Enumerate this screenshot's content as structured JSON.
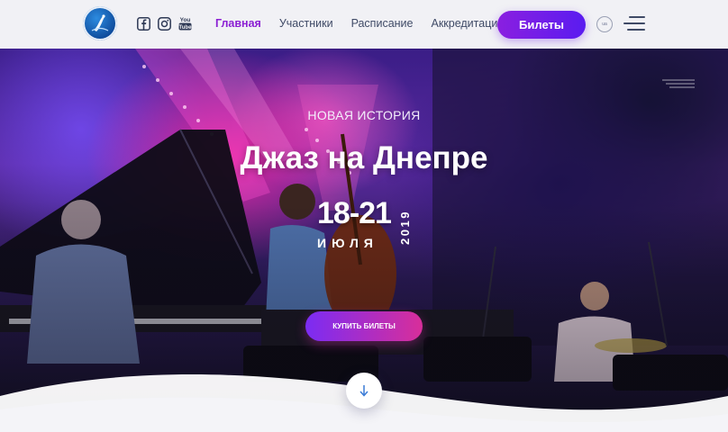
{
  "header": {
    "nav": [
      {
        "label": "Главная",
        "active": true
      },
      {
        "label": "Участники",
        "active": false
      },
      {
        "label": "Расписание",
        "active": false
      },
      {
        "label": "Аккредитация",
        "active": false
      }
    ],
    "tickets_label": "Билеты",
    "lang_label": "ua",
    "social_icons": [
      "facebook-icon",
      "instagram-icon",
      "youtube-icon"
    ],
    "youtube_text": "You Tube"
  },
  "hero": {
    "kicker": "НОВАЯ ИСТОРИЯ",
    "title": "Джаз на Днепре",
    "date_range": "18-21",
    "month": "ИЮЛЯ",
    "year": "2019",
    "buy_label": "КУПИТЬ БИЛЕТЫ"
  },
  "colors": {
    "accent_purple": "#8b1fd3",
    "button_gradient_start": "#7b2cf3",
    "button_gradient_end": "#d82e9a",
    "nav_text": "#3f4a66"
  }
}
